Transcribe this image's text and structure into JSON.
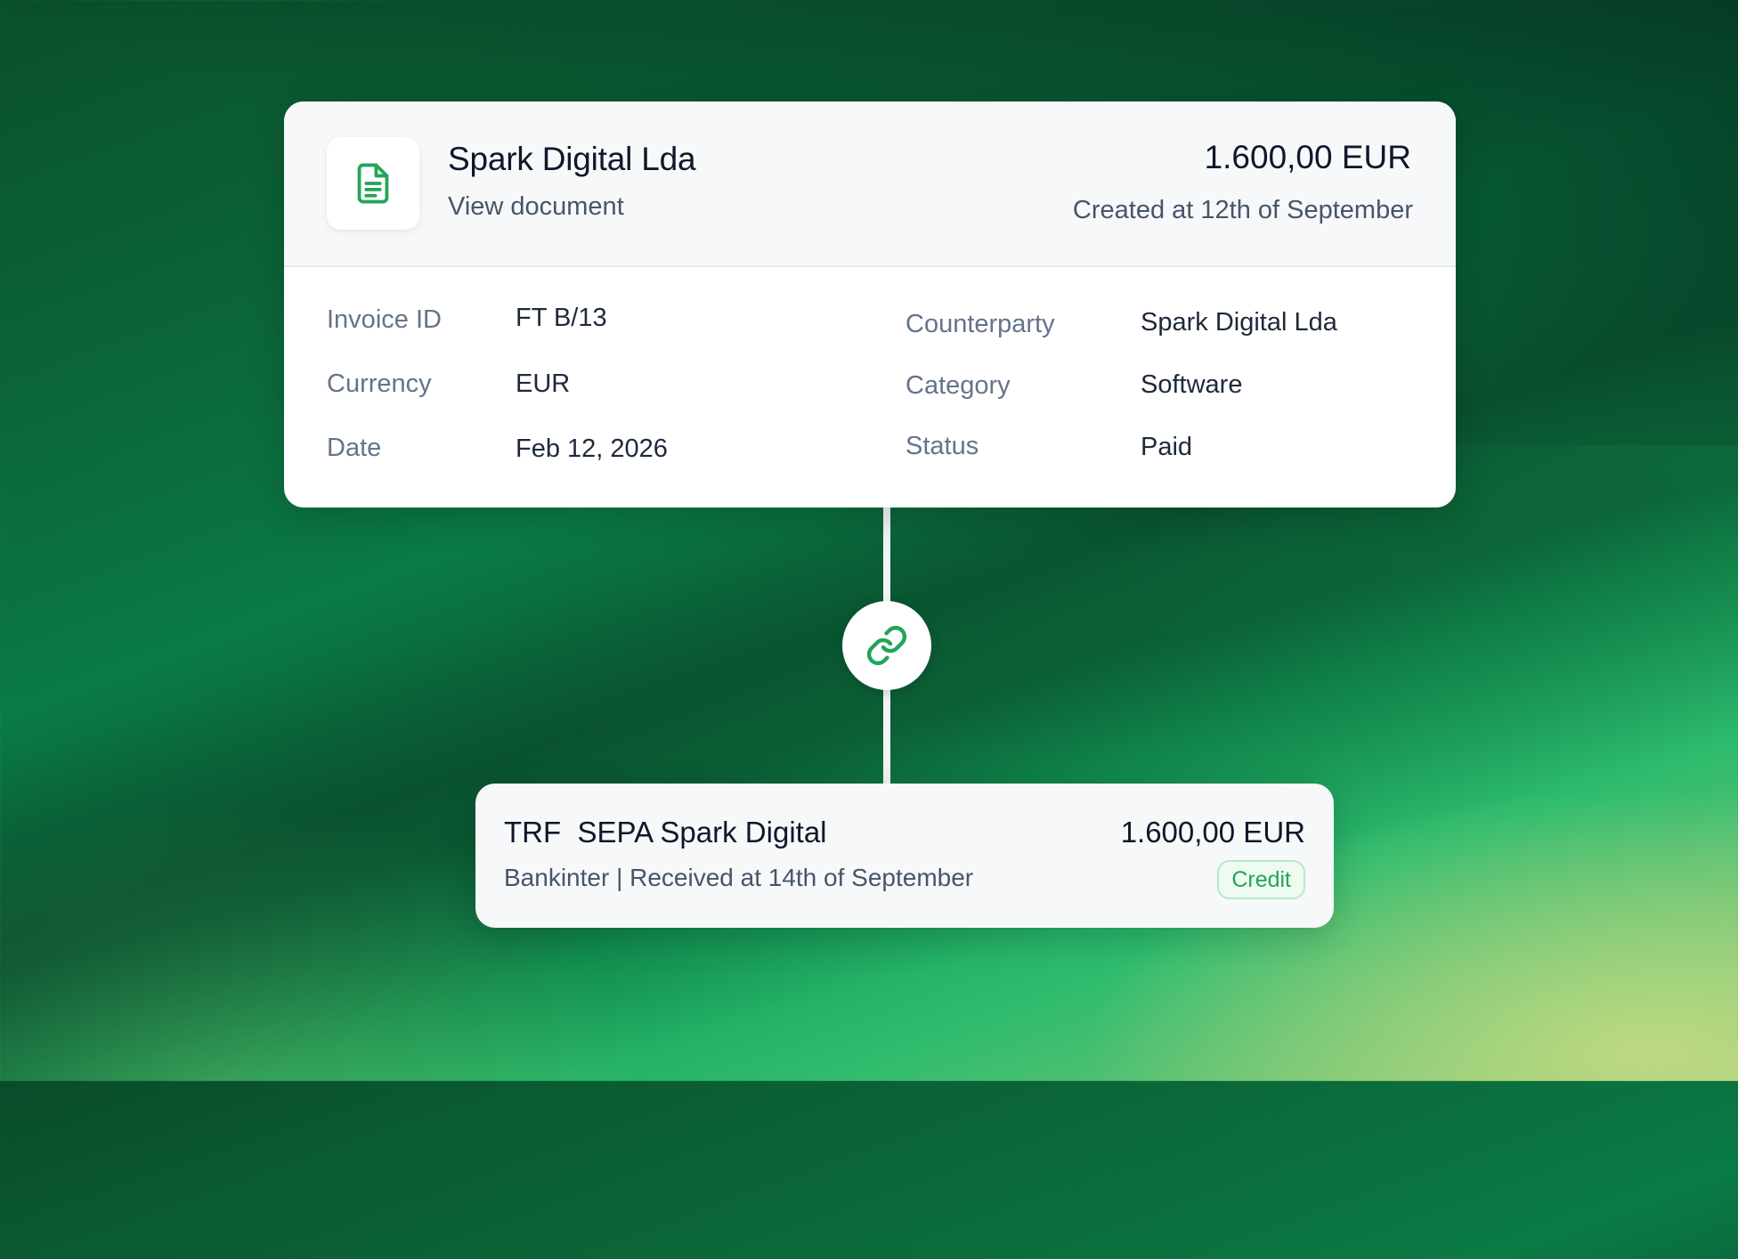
{
  "colors": {
    "accent": "#22a559",
    "card_header_bg": "#f6f8fa",
    "text_primary": "#0f172a",
    "text_secondary": "#475569",
    "label": "#64748b"
  },
  "invoice": {
    "icon": "document-icon",
    "title": "Spark Digital Lda",
    "view_document": "View document",
    "amount": "1.600,00 EUR",
    "created": "Created at 12th of September",
    "details": [
      {
        "label": "Invoice ID",
        "value": "FT B/13"
      },
      {
        "label": "Currency",
        "value": "EUR"
      },
      {
        "label": "Date",
        "value": "Feb 12, 2026"
      },
      {
        "label": "Counterparty",
        "value": "Spark Digital Lda"
      },
      {
        "label": "Category",
        "value": "Software"
      },
      {
        "label": "Status",
        "value": "Paid"
      }
    ]
  },
  "link": {
    "icon": "link-icon"
  },
  "transaction": {
    "title": "TRF  SEPA Spark Digital",
    "subtitle": "Bankinter | Received at 14th of September",
    "amount": "1.600,00 EUR",
    "badge": "Credit"
  }
}
